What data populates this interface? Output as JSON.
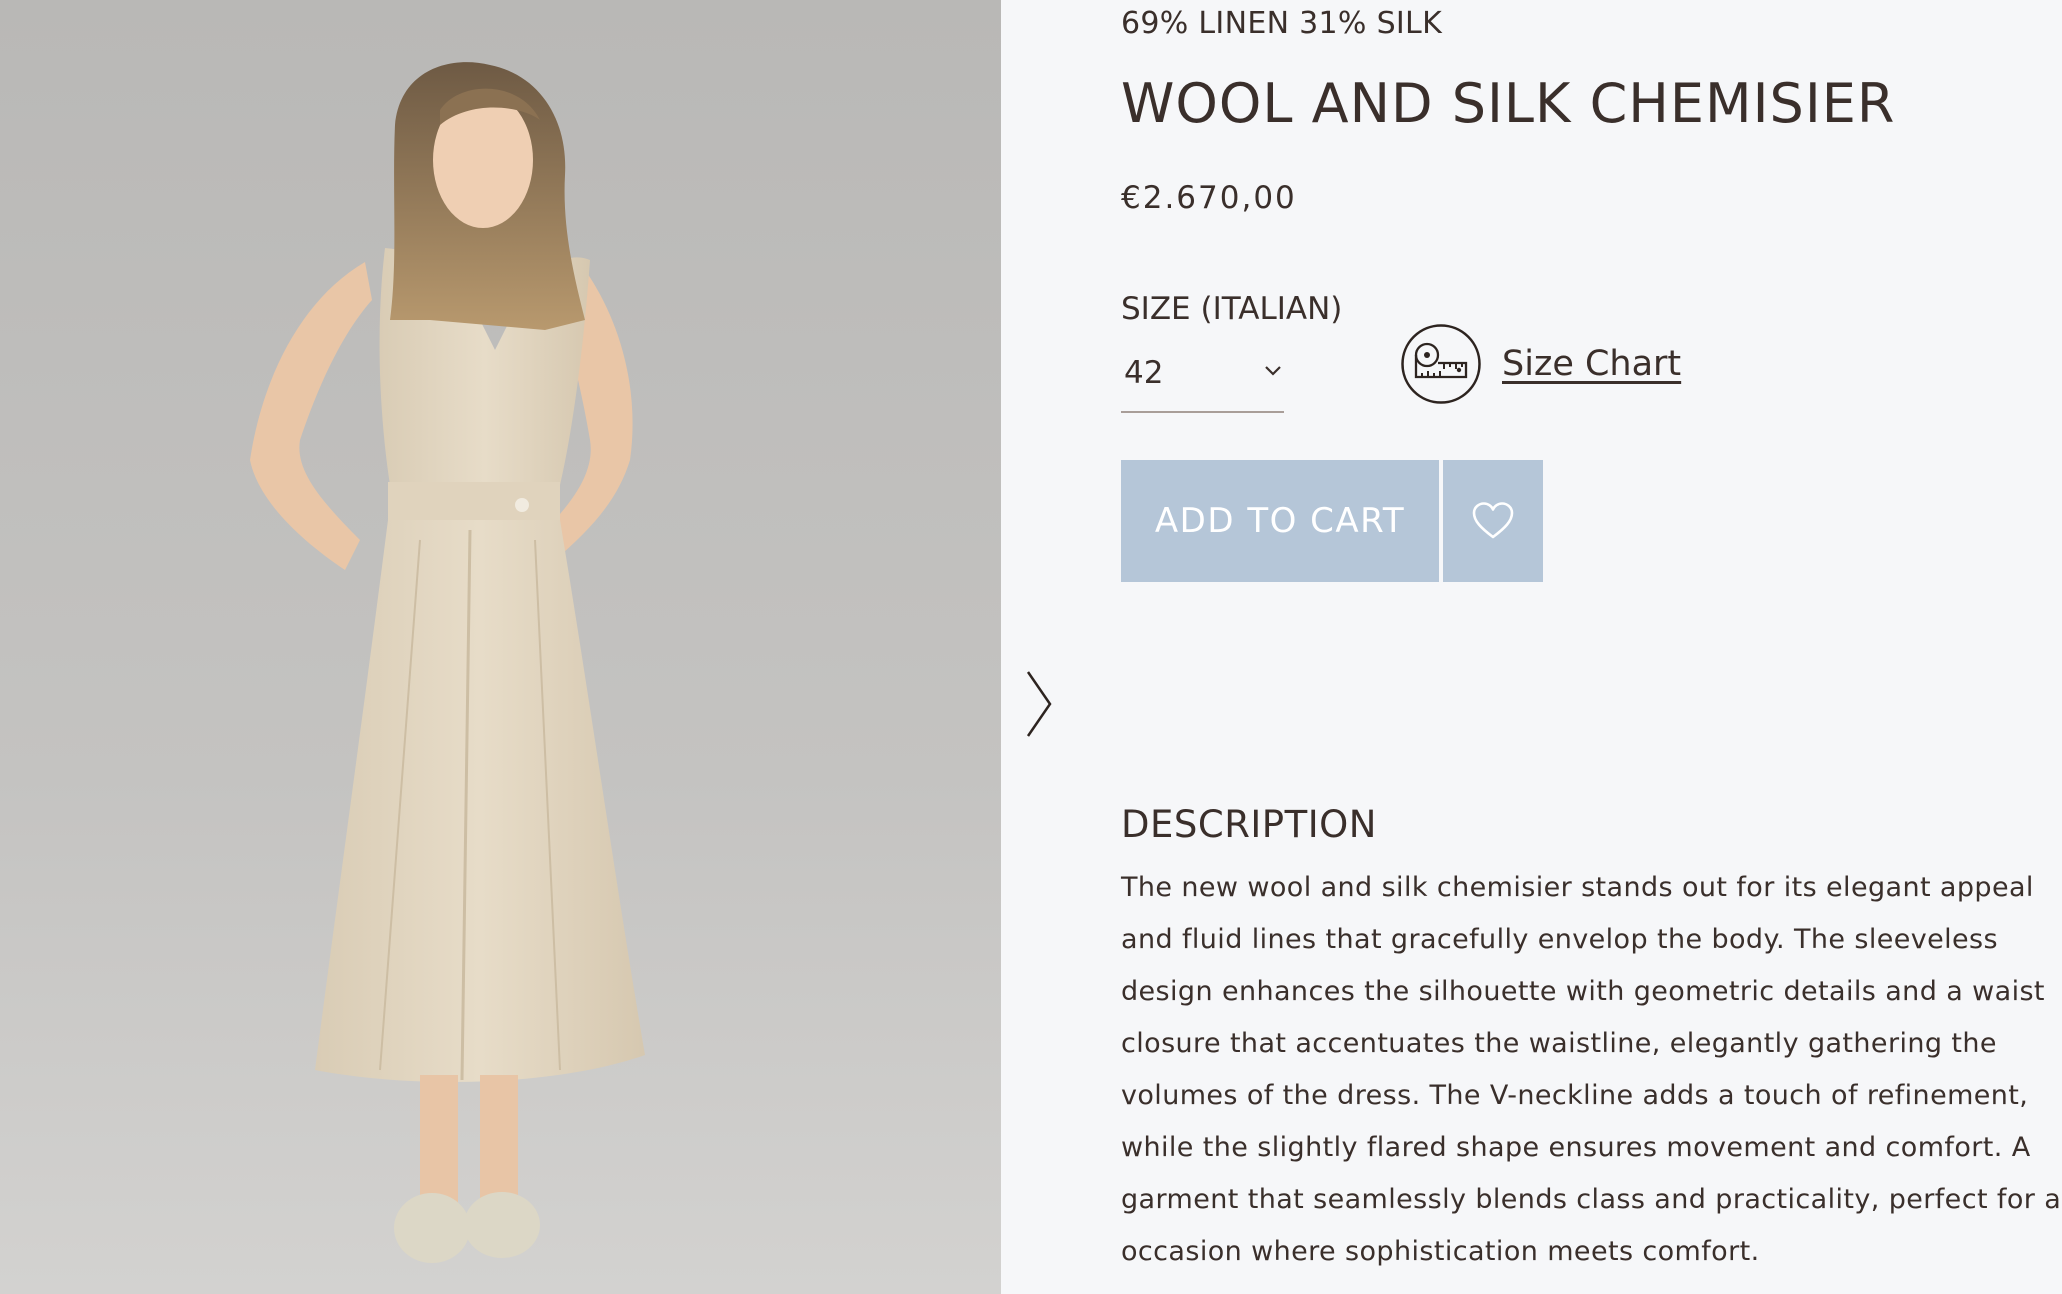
{
  "product": {
    "composition": "69% LINEN 31% SILK",
    "title": "WOOL AND SILK CHEMISIER",
    "price": "€2.670,00"
  },
  "size": {
    "label": "SIZE (ITALIAN)",
    "selected": "42",
    "chart_link": "Size Chart",
    "chart_icon": "measuring-tape-icon",
    "chevron_icon": "chevron-down-icon"
  },
  "actions": {
    "add_to_cart": "ADD TO CART",
    "wishlist_icon": "heart-icon"
  },
  "gallery": {
    "next_icon": "chevron-right-icon",
    "image": "model-in-beige-sleeveless-dress-photo"
  },
  "description": {
    "heading": "DESCRIPTION",
    "lines": [
      "The new wool and silk chemisier stands out for its elegant appeal",
      "and fluid lines that gracefully envelop the body. The sleeveless",
      "design enhances the silhouette with geometric details and a waist",
      "closure that accentuates the waistline, elegantly gathering the",
      "volumes of the dress. The V-neckline adds a touch of refinement,",
      "while the slightly flared shape ensures movement and comfort. A",
      "garment that seamlessly blends class and practicality, perfect for any",
      "occasion where sophistication meets comfort."
    ]
  },
  "colors": {
    "background": "#f6f7f9",
    "text": "#3a2f2b",
    "button": "#b5c6d8",
    "button_text": "#ffffff",
    "dress": "#e4d8c3"
  }
}
